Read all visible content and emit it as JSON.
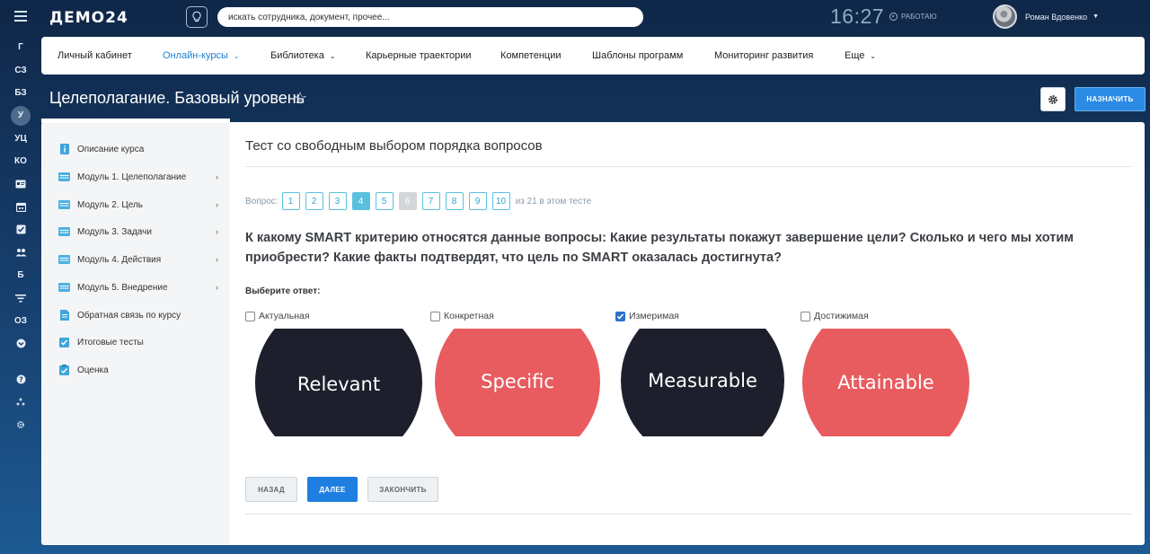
{
  "app": {
    "logo": "ДЕМО24"
  },
  "rail": {
    "items": [
      "Г",
      "СЗ",
      "БЗ",
      "У",
      "УЦ",
      "КО"
    ],
    "items2": [
      "Б"
    ],
    "items3": [
      "ОЗ"
    ],
    "icons_top": [
      "id-card-icon",
      "calendar-icon",
      "checkbox-icon",
      "people-icon"
    ],
    "icons_mid": [
      "filter-icon"
    ],
    "icons_bottom": [
      "chevron-circle-icon",
      "help-icon",
      "structure-icon",
      "settings-icon"
    ]
  },
  "topbar": {
    "search_placeholder": "искать сотрудника, документ, прочее...",
    "time": "16:27",
    "status": "РАБОТАЮ",
    "user_name": "Роман Вдовенко"
  },
  "nav": {
    "items": [
      {
        "label": "Личный кабинет"
      },
      {
        "label": "Онлайн-курсы"
      },
      {
        "label": "Библиотека"
      },
      {
        "label": "Карьерные траектории"
      },
      {
        "label": "Компетенции"
      },
      {
        "label": "Шаблоны программ"
      },
      {
        "label": "Мониторинг развития"
      },
      {
        "label": "Еще"
      }
    ]
  },
  "page": {
    "title": "Целеполагание. Базовый уровень",
    "assign_label": "НАЗНАЧИТЬ"
  },
  "sidebar": {
    "items": [
      {
        "label": "Описание курса"
      },
      {
        "label": "Модуль 1. Целеполагание"
      },
      {
        "label": "Модуль 2. Цель"
      },
      {
        "label": "Модуль 3. Задачи"
      },
      {
        "label": "Модуль 4. Действия"
      },
      {
        "label": "Модуль 5. Внедрение"
      },
      {
        "label": "Обратная связь по курсу"
      },
      {
        "label": "Итоговые тесты"
      },
      {
        "label": "Оценка"
      }
    ]
  },
  "test": {
    "title": "Тест со свободным выбором порядка вопросов",
    "pager_label": "Вопрос:",
    "pages": [
      "1",
      "2",
      "3",
      "4",
      "5",
      "6",
      "7",
      "8",
      "9",
      "10"
    ],
    "current_page": "4",
    "disabled_page": "6",
    "pager_suffix": "из 21 в этом тесте",
    "question": "К какому SMART критерию относятся данные вопросы: Какие результаты покажут завершение цели? Сколько и чего мы хотим приобрести? Какие факты подтвердят, что цель по SMART оказалась достигнута?",
    "choose_label": "Выберите ответ:",
    "options": [
      {
        "label": "Актуальная",
        "image_text": "Relevant",
        "checked": false,
        "color": "#1d1f2c"
      },
      {
        "label": "Конкретная",
        "image_text": "Specific",
        "checked": false,
        "color": "#e85c5f"
      },
      {
        "label": "Измеримая",
        "image_text": "Measurable",
        "checked": true,
        "color": "#1d1f2c"
      },
      {
        "label": "Достижимая",
        "image_text": "Attainable",
        "checked": false,
        "color": "#e85c5f"
      }
    ],
    "buttons": {
      "back": "НАЗАД",
      "next": "ДАЛЕЕ",
      "finish": "ЗАКОНЧИТЬ"
    }
  },
  "colors": {
    "accent": "#1a7fd6",
    "primary_button": "#1f7fe0",
    "pager": "#5bc0de"
  }
}
